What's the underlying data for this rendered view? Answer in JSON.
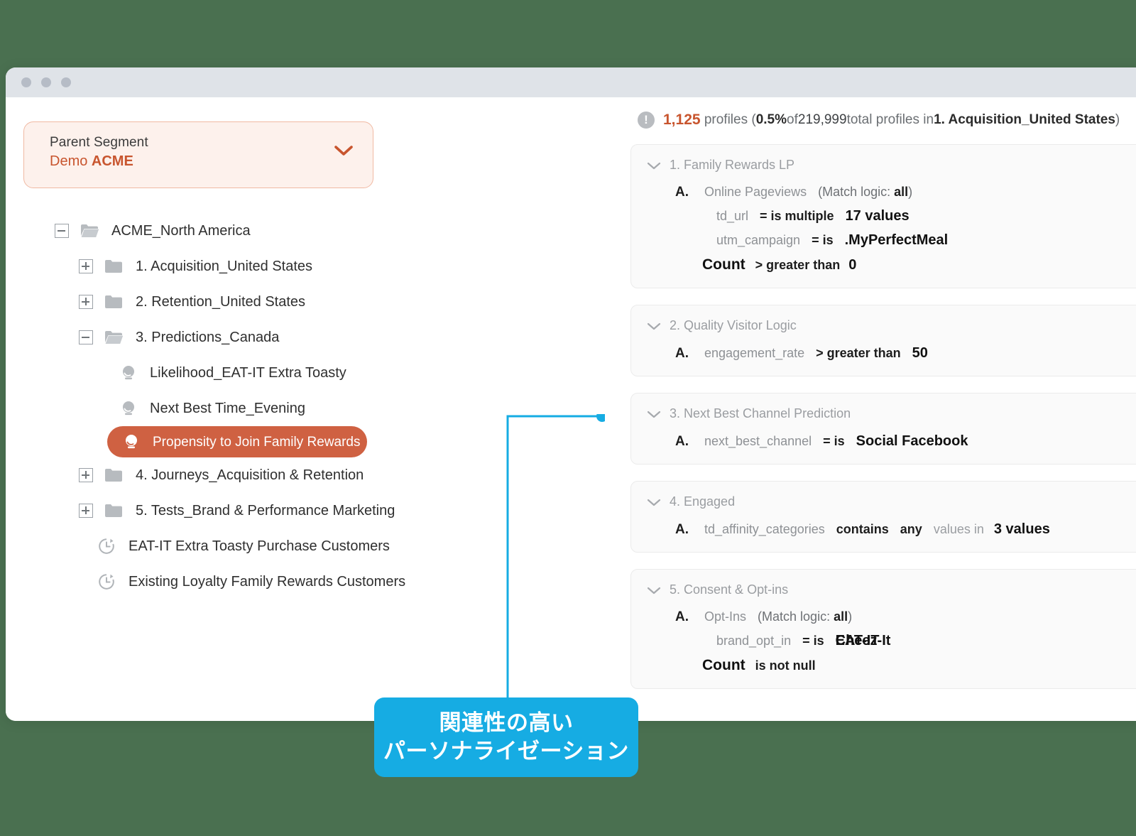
{
  "window": {
    "traffic_lights": [
      "dot-red",
      "dot-yellow",
      "dot-green"
    ]
  },
  "sidebar": {
    "parent_segment": {
      "label": "Parent Segment",
      "value_prefix": "Demo ",
      "value_bold": "ACME",
      "chevron": "chevron-down-icon"
    },
    "tree": [
      {
        "level": 0,
        "toggle": "minus",
        "icon": "folder-open-icon",
        "label": "ACME_North America"
      },
      {
        "level": 1,
        "toggle": "plus",
        "icon": "folder-icon",
        "label": "1. Acquisition_United States"
      },
      {
        "level": 1,
        "toggle": "plus",
        "icon": "folder-icon",
        "label": "2. Retention_United States"
      },
      {
        "level": 1,
        "toggle": "minus",
        "icon": "folder-open-icon",
        "label": "3. Predictions_Canada"
      },
      {
        "level": 2,
        "toggle": null,
        "icon": "prediction-icon",
        "label": "Likelihood_EAT-IT Extra Toasty"
      },
      {
        "level": 2,
        "toggle": null,
        "icon": "prediction-icon",
        "label": "Next Best Time_Evening"
      },
      {
        "level": 2,
        "toggle": null,
        "icon": "prediction-icon",
        "label": "Propensity to Join Family Rewards",
        "active": true
      },
      {
        "level": 1,
        "toggle": "plus",
        "icon": "folder-icon",
        "label": "4. Journeys_Acquisition & Retention"
      },
      {
        "level": 1,
        "toggle": "plus",
        "icon": "folder-icon",
        "label": "5. Tests_Brand & Performance Marketing"
      },
      {
        "level": 1,
        "toggle": null,
        "icon": "clock-history-icon",
        "label": "EAT-IT  Extra Toasty Purchase Customers"
      },
      {
        "level": 1,
        "toggle": null,
        "icon": "clock-history-icon",
        "label": "Existing Loyalty Family Rewards Customers"
      }
    ]
  },
  "main": {
    "stats": {
      "icon": "info-exclamation-icon",
      "profile_count": "1,125",
      "profiles_word": "profiles (",
      "percent": "0.5%",
      "of_word": " of ",
      "total": "219,999",
      "total_suffix": " total profiles in ",
      "segment": "1. Acquisition_United States",
      "close_paren": ")"
    },
    "cards": [
      {
        "title": "1. Family Rewards LP",
        "chevron": "chevron-down-icon",
        "rules": [
          {
            "kind": "group",
            "letter": "A.",
            "name": "Online Pageviews",
            "match_logic_prefix": "(Match logic: ",
            "match_logic": "all",
            "match_logic_suffix": ")"
          },
          {
            "kind": "sub",
            "attr": "td_url",
            "op": "= is multiple",
            "value": "17 values"
          },
          {
            "kind": "sub",
            "attr": "utm_campaign",
            "op": "= is",
            "value": ".MyPerfectMeal"
          },
          {
            "kind": "count",
            "label": "Count",
            "op": "> greater than",
            "value": "0"
          }
        ]
      },
      {
        "title": "2. Quality Visitor Logic",
        "chevron": "chevron-down-icon",
        "rules": [
          {
            "kind": "attr",
            "letter": "A.",
            "attr": "engagement_rate",
            "op": "> greater than",
            "value": "50"
          }
        ]
      },
      {
        "title": "3. Next Best Channel Prediction",
        "chevron": "chevron-down-icon",
        "rules": [
          {
            "kind": "attr",
            "letter": "A.",
            "attr": "next_best_channel",
            "op": "= is",
            "value": "Social Facebook"
          }
        ]
      },
      {
        "title": "4. Engaged",
        "chevron": "chevron-down-icon",
        "rules": [
          {
            "kind": "contains",
            "letter": "A.",
            "attr": "td_affinity_categories",
            "op": "contains",
            "any": "any",
            "muted": "values in",
            "value": "3 values"
          }
        ]
      },
      {
        "title": "5. Consent & Opt-ins",
        "chevron": "chevron-down-icon",
        "rules": [
          {
            "kind": "group",
            "letter": "A.",
            "name": "Opt-Ins",
            "match_logic_prefix": "(Match logic: ",
            "match_logic": "all",
            "match_logic_suffix": ")"
          },
          {
            "kind": "sub-overlap",
            "attr": "brand_opt_in",
            "op": "= is",
            "value_a": "EAT-IT",
            "value_b": "Cheez-It"
          },
          {
            "kind": "count",
            "label": "Count",
            "op": "is not null",
            "value": ""
          }
        ]
      }
    ]
  },
  "callout": {
    "line1": "関連性の高い",
    "line2": "パーソナライゼーション",
    "color": "#16ace3",
    "connector_dot": "connector-endpoint-dot"
  },
  "colors": {
    "background_green": "#4a7050",
    "accent_orange": "#c8552e",
    "active_pill": "#cf6142",
    "callout_blue": "#16ace3",
    "titlebar": "#dfe3e8"
  }
}
